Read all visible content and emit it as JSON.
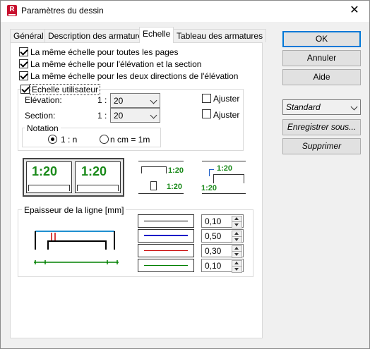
{
  "window": {
    "title": "Paramètres du dessin",
    "app_icon": "R"
  },
  "tabs": [
    {
      "label": "Général"
    },
    {
      "label": "Description des armatures"
    },
    {
      "label": "Echelle"
    },
    {
      "label": "Tableau des armatures"
    }
  ],
  "options": {
    "same_scale_all_pages": "La même échelle pour toutes les pages",
    "same_scale_elev_section": "La même échelle pour l'élévation et la section",
    "same_scale_both_dirs": "La même échelle pour les deux directions de l'élévation",
    "user_scale": "Echelle utilisateur"
  },
  "scale": {
    "elevation_label": "Elévation:",
    "section_label": "Section:",
    "prefix": "1 :",
    "elevation_value": "20",
    "section_value": "20",
    "adjust_label": "Ajuster"
  },
  "notation": {
    "group_label": "Notation",
    "option1": "1 : n",
    "option2": "n cm = 1m"
  },
  "preview": {
    "scale_text": "1:20"
  },
  "line_thickness": {
    "group_label": "Epaisseur de la ligne [mm]",
    "rows": [
      {
        "value": "0,10",
        "color": "#000000"
      },
      {
        "value": "0,50",
        "color": "#0000c8"
      },
      {
        "value": "0,30",
        "color": "#c80000"
      },
      {
        "value": "0,10",
        "color": "#008000"
      }
    ]
  },
  "buttons": {
    "ok": "OK",
    "cancel": "Annuler",
    "help": "Aide"
  },
  "style": {
    "selected": "Standard",
    "save": "Enregistrer sous...",
    "delete": "Supprimer"
  }
}
